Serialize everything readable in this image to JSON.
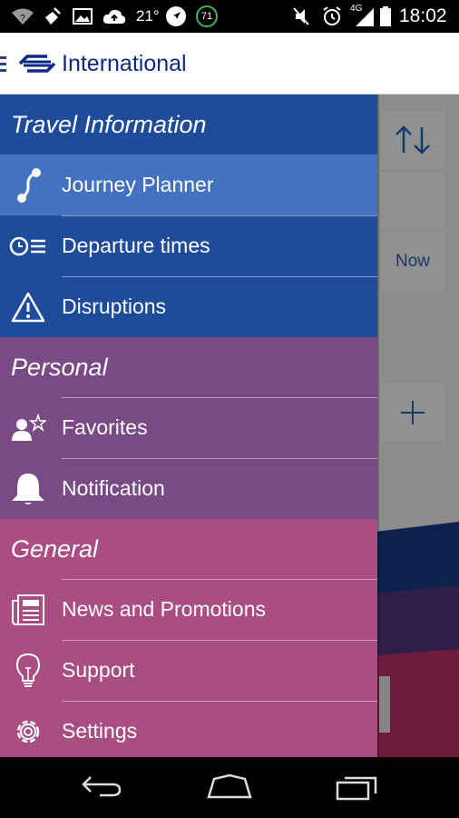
{
  "status_bar": {
    "temperature": "21°",
    "badge_value": "71",
    "network": "4G",
    "time": "18:02",
    "icons": [
      "wifi-icon",
      "broom-icon",
      "image-icon",
      "cloud-upload-icon",
      "navigation-icon",
      "speed-badge-icon",
      "mute-icon",
      "alarm-icon",
      "signal-icon",
      "battery-icon"
    ]
  },
  "app_bar": {
    "title": "International",
    "logo": "ns-logo"
  },
  "background": {
    "swap_icon": "swap-arrows-icon",
    "now_label": "Now",
    "add_icon": "plus-icon"
  },
  "drawer": {
    "sections": [
      {
        "title": "Travel Information",
        "color": "#1f4b9b",
        "items": [
          {
            "label": "Journey Planner",
            "icon": "route-icon",
            "active": true
          },
          {
            "label": "Departure times",
            "icon": "departures-icon",
            "active": false
          },
          {
            "label": "Disruptions",
            "icon": "warning-icon",
            "active": false
          }
        ]
      },
      {
        "title": "Personal",
        "color": "#7a4a85",
        "items": [
          {
            "label": "Favorites",
            "icon": "favorite-person-icon",
            "active": false
          },
          {
            "label": "Notification",
            "icon": "bell-icon",
            "active": false
          }
        ]
      },
      {
        "title": "General",
        "color": "#a94d83",
        "items": [
          {
            "label": "News and Promotions",
            "icon": "newspaper-icon",
            "active": false
          },
          {
            "label": "Support",
            "icon": "lightbulb-icon",
            "active": false
          },
          {
            "label": "Settings",
            "icon": "gear-icon",
            "active": false
          }
        ]
      }
    ]
  },
  "colors": {
    "brand_blue": "#0b2a82",
    "active_item": "#4471c0"
  },
  "nav_bar": {
    "icons": [
      "back-icon",
      "home-icon",
      "recent-apps-icon"
    ]
  }
}
